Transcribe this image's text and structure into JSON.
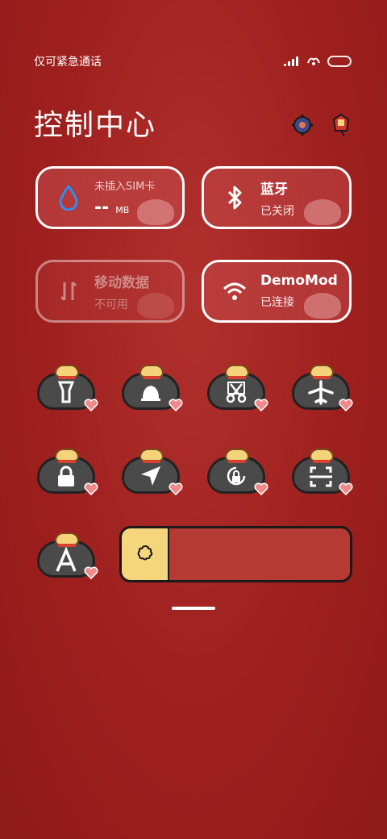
{
  "status": {
    "carrier": "仅可紧急通话",
    "icons": [
      "signal-icon",
      "wifi-calling-icon",
      "battery-icon"
    ]
  },
  "header": {
    "title": "控制中心",
    "icons": [
      "settings-gear-icon",
      "edit-tag-icon"
    ]
  },
  "tiles": {
    "data_usage": {
      "title": "未插入SIM卡",
      "value": "--",
      "unit": "MB",
      "icon": "water-drop-icon"
    },
    "bluetooth": {
      "title": "蓝牙",
      "status": "已关闭",
      "icon": "bluetooth-icon"
    },
    "mobile_data": {
      "title": "移动数据",
      "status": "不可用",
      "icon": "data-arrows-icon"
    },
    "wifi": {
      "title": "DemoMod",
      "status": "已连接",
      "icon": "wifi-icon"
    }
  },
  "toggles": [
    {
      "name": "flashlight",
      "icon": "flashlight-icon"
    },
    {
      "name": "sound",
      "icon": "bell-icon"
    },
    {
      "name": "screenshot",
      "icon": "scissors-icon"
    },
    {
      "name": "airplane",
      "icon": "airplane-icon"
    },
    {
      "name": "lock",
      "icon": "lock-icon"
    },
    {
      "name": "location",
      "icon": "location-arrow-icon"
    },
    {
      "name": "rotation-lock",
      "icon": "rotation-lock-icon"
    },
    {
      "name": "scan",
      "icon": "scan-icon"
    },
    {
      "name": "auto-brightness",
      "icon": "letter-a-icon"
    }
  ],
  "brightness": {
    "level": 0.21,
    "icon": "brightness-sun-icon"
  },
  "colors": {
    "background": "#9e201e",
    "tile_border": "#ffffff",
    "slider_fill": "#f5d67c",
    "slider_track": "#b53a33"
  }
}
